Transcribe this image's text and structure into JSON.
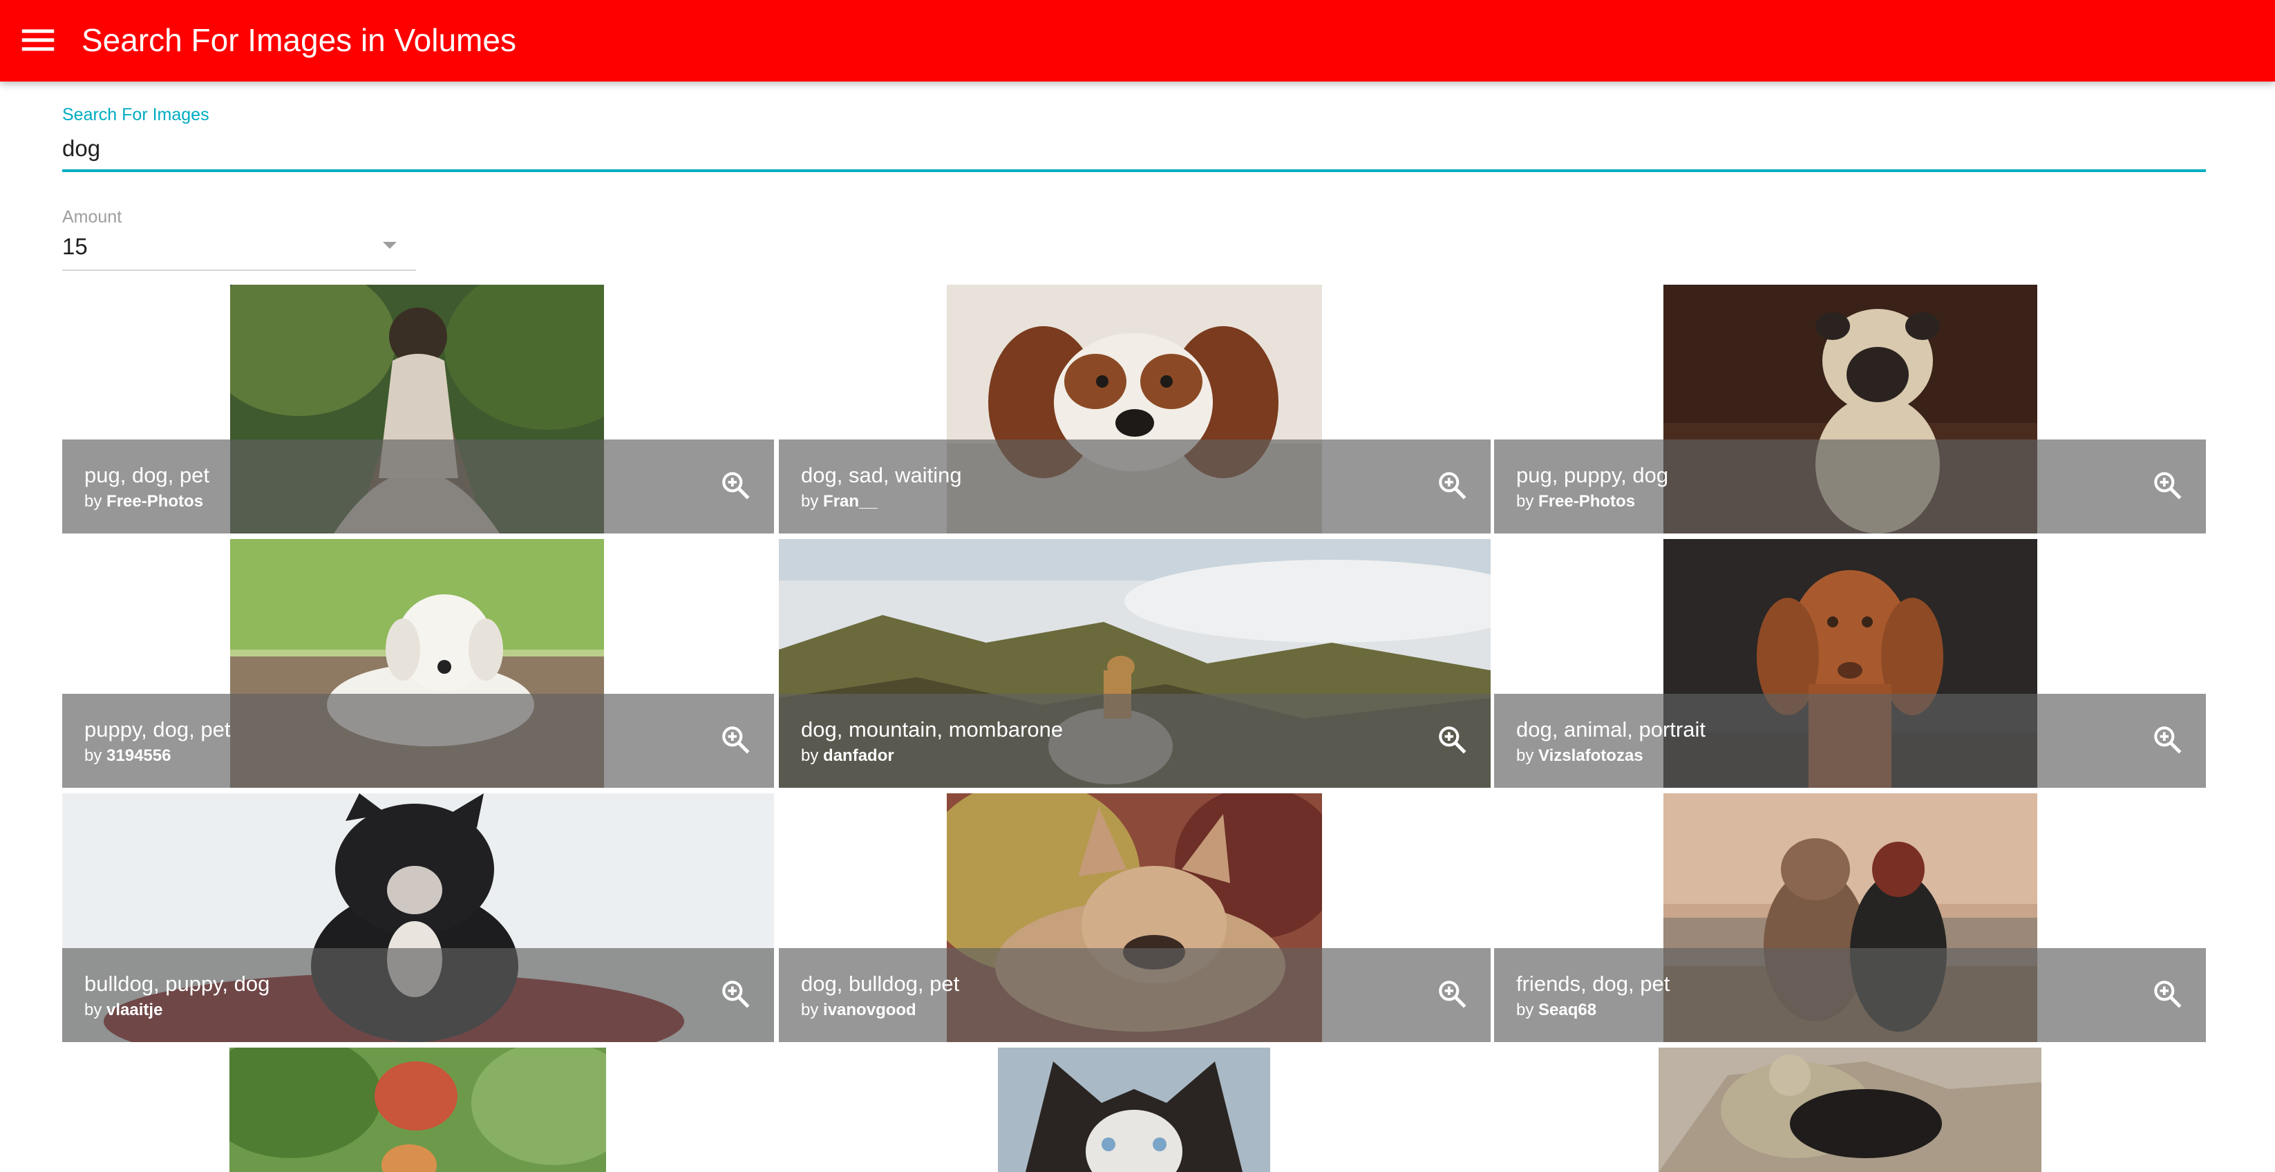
{
  "appbar": {
    "title": "Search For Images in Volumes",
    "menu_icon": "menu-icon",
    "color": "#ff0000"
  },
  "search": {
    "label": "Search For Images",
    "value": "dog",
    "accent_color": "#00acc1"
  },
  "amount": {
    "label": "Amount",
    "value": "15"
  },
  "tiles": [
    {
      "title": "pug, dog, pet",
      "by": "by",
      "author": "Free-Photos",
      "zoom_icon": "zoom-in-icon"
    },
    {
      "title": "dog, sad, waiting",
      "by": "by",
      "author": "Fran__",
      "zoom_icon": "zoom-in-icon"
    },
    {
      "title": "pug, puppy, dog",
      "by": "by",
      "author": "Free-Photos",
      "zoom_icon": "zoom-in-icon"
    },
    {
      "title": "puppy, dog, pet",
      "by": "by",
      "author": "3194556",
      "zoom_icon": "zoom-in-icon"
    },
    {
      "title": "dog, mountain, mombarone",
      "by": "by",
      "author": "danfador",
      "zoom_icon": "zoom-in-icon"
    },
    {
      "title": "dog, animal, portrait",
      "by": "by",
      "author": "Vizslafotozas",
      "zoom_icon": "zoom-in-icon"
    },
    {
      "title": "bulldog, puppy, dog",
      "by": "by",
      "author": "vlaaitje",
      "zoom_icon": "zoom-in-icon"
    },
    {
      "title": "dog, bulldog, pet",
      "by": "by",
      "author": "ivanovgood",
      "zoom_icon": "zoom-in-icon"
    },
    {
      "title": "friends, dog, pet",
      "by": "by",
      "author": "Seaq68",
      "zoom_icon": "zoom-in-icon"
    }
  ]
}
